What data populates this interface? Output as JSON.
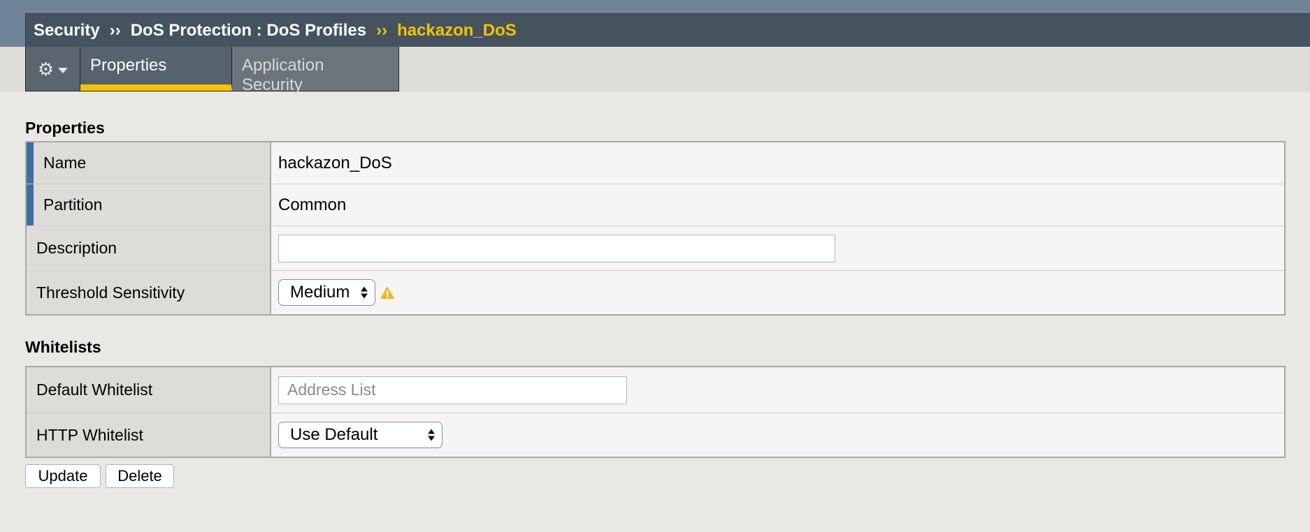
{
  "breadcrumb": {
    "section": "Security",
    "separator": "››",
    "module": "DoS Protection : DoS Profiles",
    "current": "hackazon_DoS"
  },
  "tabs": {
    "gear_icon": "gear-icon",
    "items": [
      {
        "label": "Properties",
        "active": true
      },
      {
        "label": "Application Security",
        "active": false
      }
    ]
  },
  "properties_section": {
    "title": "Properties",
    "rows": {
      "name": {
        "label": "Name",
        "value": "hackazon_DoS"
      },
      "partition": {
        "label": "Partition",
        "value": "Common"
      },
      "description": {
        "label": "Description",
        "value": "",
        "placeholder": ""
      },
      "threshold_sensitivity": {
        "label": "Threshold Sensitivity",
        "value": "Medium",
        "warning_icon": "warning-icon"
      }
    }
  },
  "whitelists_section": {
    "title": "Whitelists",
    "rows": {
      "default_whitelist": {
        "label": "Default Whitelist",
        "value": "",
        "placeholder": "Address List"
      },
      "http_whitelist": {
        "label": "HTTP Whitelist",
        "value": "Use Default"
      }
    }
  },
  "buttons": {
    "update": "Update",
    "delete": "Delete"
  },
  "colors": {
    "accent_yellow": "#f5c300",
    "header_dark": "#45535f",
    "required_marker": "#3f6fa4",
    "warning": "#f0b429"
  }
}
